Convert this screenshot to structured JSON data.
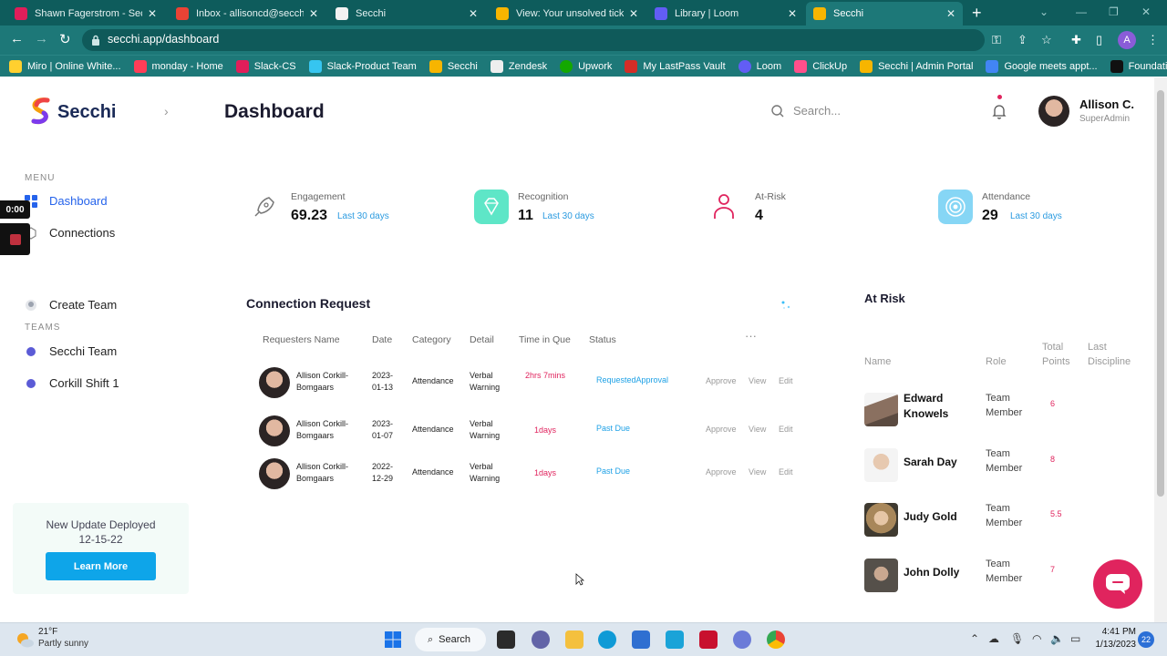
{
  "browser": {
    "tabs": [
      {
        "label": "Shawn Fagerstrom - Secchi",
        "color": "#e01e5a"
      },
      {
        "label": "Inbox - allisoncd@secchi.io",
        "color": "#ea4335"
      },
      {
        "label": "Secchi",
        "color": "#111111"
      },
      {
        "label": "View: Your unsolved tickets",
        "color": "#1f73b7"
      },
      {
        "label": "Library | Loom",
        "color": "#625df5"
      },
      {
        "label": "Secchi",
        "color": "#f7b500"
      }
    ],
    "new_tab": "+",
    "url": "secchi.app/dashboard",
    "profile_initial": "A",
    "bookmarks": [
      {
        "label": "Miro | Online White...",
        "color": "#ffd02f"
      },
      {
        "label": "monday - Home",
        "color": "#ff3d57"
      },
      {
        "label": "Slack-CS",
        "color": "#e01e5a"
      },
      {
        "label": "Slack-Product Team",
        "color": "#36c5f0"
      },
      {
        "label": "Secchi",
        "color": "#f7b500"
      },
      {
        "label": "Zendesk",
        "color": "#111111"
      },
      {
        "label": "Upwork",
        "color": "#14a800"
      },
      {
        "label": "My LastPass Vault",
        "color": "#d32d27"
      },
      {
        "label": "Loom",
        "color": "#625df5"
      },
      {
        "label": "ClickUp",
        "color": "#ff4f8b"
      },
      {
        "label": "Secchi | Admin Portal",
        "color": "#f7b500"
      },
      {
        "label": "Google meets appt...",
        "color": "#4285f4"
      },
      {
        "label": "Foundational Supp...",
        "color": "#111111"
      }
    ]
  },
  "app": {
    "logo_text": "Secchi",
    "page_title": "Dashboard",
    "search_placeholder": "Search...",
    "user": {
      "name": "Allison C.",
      "role": "SuperAdmin"
    },
    "recorder": {
      "time": "0:00"
    },
    "sidebar": {
      "menu_heading": "MENU",
      "menu_items": [
        {
          "label": "Dashboard",
          "active": true
        },
        {
          "label": "Connections",
          "active": false
        }
      ],
      "create_team": "Create Team",
      "teams_heading": "TEAMS",
      "teams": [
        {
          "label": "Secchi Team",
          "color": "#5b5bd6"
        },
        {
          "label": "Corkill Shift 1",
          "color": "#5b5bd6"
        }
      ],
      "update": {
        "title": "New Update Deployed",
        "date": "12-15-22",
        "button": "Learn More"
      }
    },
    "kpis": [
      {
        "label": "Engagement",
        "value": "69.23",
        "sub": "Last 30 days",
        "icon": "rocket-icon"
      },
      {
        "label": "Recognition",
        "value": "11",
        "sub": "Last 30 days",
        "icon": "diamond-icon"
      },
      {
        "label": "At-Risk",
        "value": "4",
        "sub": "",
        "icon": "person-icon"
      },
      {
        "label": "Attendance",
        "value": "29",
        "sub": "Last 30 days",
        "icon": "target-icon"
      }
    ],
    "connection_request": {
      "title": "Connection Request",
      "more": "···",
      "columns": [
        "Requesters Name",
        "Date",
        "Category",
        "Detail",
        "Time in Que",
        "Status"
      ],
      "rows": [
        {
          "name": "Allison Corkill-Bomgaars",
          "date": "2023-01-13",
          "category": "Attendance",
          "detail": "Verbal Warning",
          "time": "2hrs 7mins",
          "status": "RequestedApproval",
          "actions": [
            "Approve",
            "View",
            "Edit"
          ]
        },
        {
          "name": "Allison Corkill-Bomgaars",
          "date": "2023-01-07",
          "category": "Attendance",
          "detail": "Verbal Warning",
          "time": "1days",
          "status": "Past Due",
          "actions": [
            "Approve",
            "View",
            "Edit"
          ]
        },
        {
          "name": "Allison Corkill-Bomgaars",
          "date": "2022-12-29",
          "category": "Attendance",
          "detail": "Verbal Warning",
          "time": "1days",
          "status": "Past Due",
          "actions": [
            "Approve",
            "View",
            "Edit"
          ]
        }
      ]
    },
    "at_risk": {
      "title": "At Risk",
      "columns": [
        "Name",
        "Role",
        "Total Points",
        "Last Discipline"
      ],
      "rows": [
        {
          "name": "Edward Knowels",
          "role": "Team Member",
          "points": "6",
          "color": "#8a7060"
        },
        {
          "name": "Sarah Day",
          "role": "Team Member",
          "points": "8",
          "color": "#e7d6c6"
        },
        {
          "name": "Judy Gold",
          "role": "Team Member",
          "points": "5.5",
          "color": "#a8875a"
        },
        {
          "name": "John Dolly",
          "role": "Team Member",
          "points": "7",
          "color": "#55504a"
        }
      ]
    }
  },
  "taskbar": {
    "temp": "21°F",
    "weather": "Partly sunny",
    "search_label": "Search",
    "time": "4:41 PM",
    "date": "1/13/2023",
    "notifications": "22"
  }
}
